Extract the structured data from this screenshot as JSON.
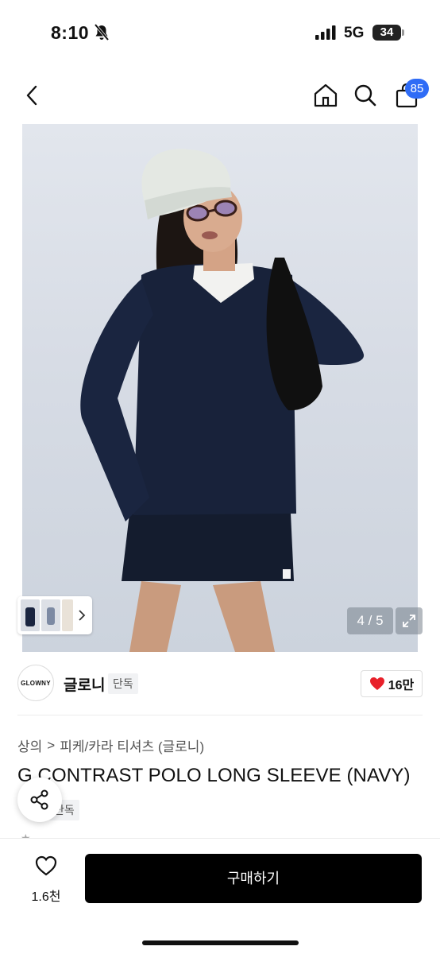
{
  "status": {
    "time": "8:10",
    "network": "5G",
    "battery": "34"
  },
  "nav": {
    "cart_count": "85"
  },
  "gallery": {
    "page_indicator": "4 / 5",
    "total_thumbs": 3
  },
  "brand": {
    "logo_text": "GLOWNY",
    "name": "글로니",
    "exclusive_badge": "단독",
    "likes": "16만"
  },
  "breadcrumb": {
    "items": [
      "상의",
      "피케/카라 티셔츠 (글로니)"
    ],
    "separator": ">"
  },
  "product": {
    "title": "G CONTRAST POLO LONG SLEEVE (NAVY)",
    "exclusive_badge": "단독"
  },
  "bottom_bar": {
    "wish_count": "1.6천",
    "buy_label": "구매하기"
  },
  "colors": {
    "accent": "#2f6cf6",
    "heart": "#e8202a",
    "buy_button": "#000000"
  }
}
